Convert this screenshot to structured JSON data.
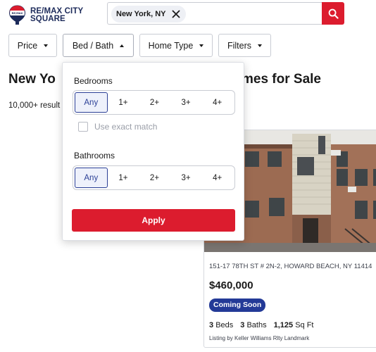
{
  "brand": {
    "logo_line1": "RE/MAX CITY",
    "logo_line2": "SQUARE",
    "accent": "#dc1c2e",
    "navy": "#1c2a5a"
  },
  "search": {
    "chip_label": "New York, NY",
    "chip_icon": "close-icon",
    "button_icon": "search-icon"
  },
  "filters": [
    {
      "label": "Price",
      "state": "closed"
    },
    {
      "label": "Bed / Bath",
      "state": "open"
    },
    {
      "label": "Home Type",
      "state": "closed"
    },
    {
      "label": "Filters",
      "state": "closed"
    }
  ],
  "page": {
    "heading_left": "New Yo",
    "heading_right": "mes for Sale",
    "results": "10,000+ result"
  },
  "bed_bath_dropdown": {
    "bedrooms_label": "Bedrooms",
    "bedroom_options": [
      "Any",
      "1+",
      "2+",
      "3+",
      "4+"
    ],
    "bedroom_selected": "Any",
    "exact_match_label": "Use exact match",
    "exact_match_checked": false,
    "bathrooms_label": "Bathrooms",
    "bathroom_options": [
      "Any",
      "1+",
      "2+",
      "3+",
      "4+"
    ],
    "bathroom_selected": "Any",
    "apply_label": "Apply"
  },
  "listing": {
    "address": "151-17 78TH ST # 2N-2, HOWARD BEACH, NY 11414",
    "price": "$460,000",
    "status_badge": "Coming Soon",
    "badge_color": "#233a97",
    "beds_value": "3",
    "beds_unit": "Beds",
    "baths_value": "3",
    "baths_unit": "Baths",
    "sqft_value": "1,125",
    "sqft_unit": "Sq Ft",
    "listed_by": "Listing by Keller Williams Rlty Landmark"
  }
}
